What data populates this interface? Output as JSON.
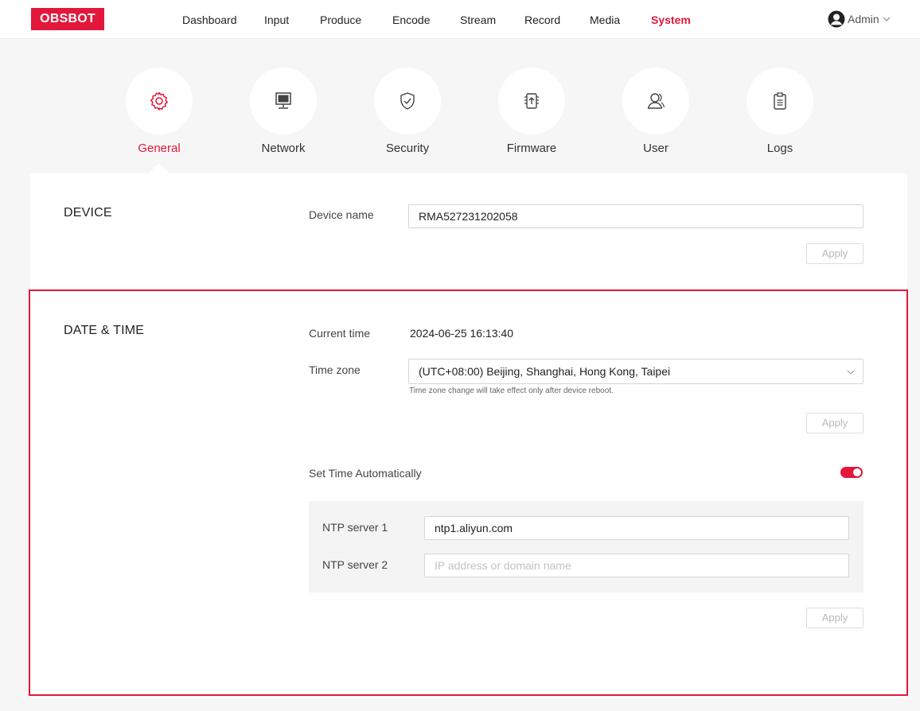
{
  "header": {
    "logo": "OBSBOT",
    "nav": [
      {
        "label": "Dashboard"
      },
      {
        "label": "Input"
      },
      {
        "label": "Produce"
      },
      {
        "label": "Encode"
      },
      {
        "label": "Stream"
      },
      {
        "label": "Record"
      },
      {
        "label": "Media"
      },
      {
        "label": "System",
        "active": true
      }
    ],
    "user": {
      "label": "Admin",
      "icon": "user-avatar-icon"
    }
  },
  "categories": [
    {
      "label": "General",
      "icon": "gear-icon",
      "active": true
    },
    {
      "label": "Network",
      "icon": "monitor-icon"
    },
    {
      "label": "Security",
      "icon": "shield-check-icon"
    },
    {
      "label": "Firmware",
      "icon": "upload-chip-icon"
    },
    {
      "label": "User",
      "icon": "users-icon"
    },
    {
      "label": "Logs",
      "icon": "clipboard-icon"
    }
  ],
  "device": {
    "title": "DEVICE",
    "name_label": "Device name",
    "name_value": "RMA527231202058",
    "apply_label": "Apply"
  },
  "datetime": {
    "title": "DATE & TIME",
    "current_label": "Current time",
    "current_value": "2024-06-25 16:13:40",
    "timezone_label": "Time zone",
    "timezone_value": "(UTC+08:00) Beijing, Shanghai, Hong Kong, Taipei",
    "timezone_hint": "Time zone change will take effect only after device reboot.",
    "apply_label": "Apply",
    "auto_label": "Set Time Automatically",
    "auto_enabled": true,
    "ntp1_label": "NTP server 1",
    "ntp1_value": "ntp1.aliyun.com",
    "ntp2_label": "NTP server 2",
    "ntp2_placeholder": "IP address or domain name",
    "apply2_label": "Apply"
  },
  "colors": {
    "accent": "#e3173b",
    "background": "#f6f6f6"
  }
}
